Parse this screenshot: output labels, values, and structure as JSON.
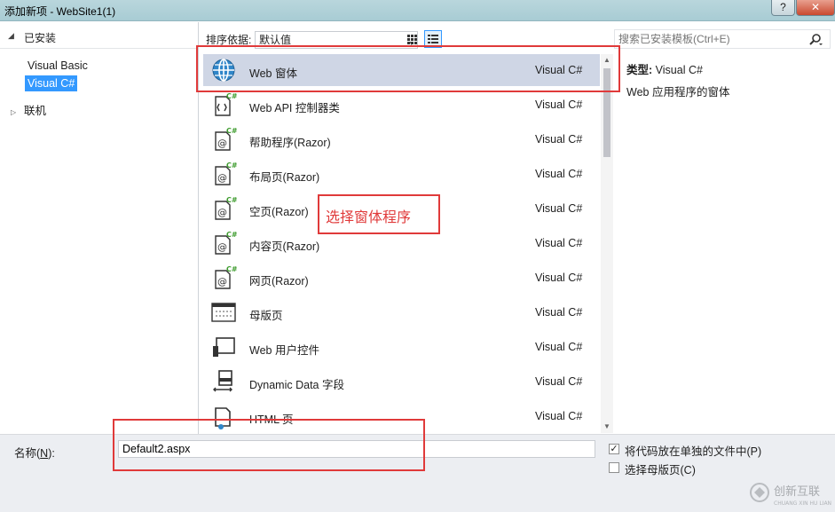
{
  "window": {
    "title": "添加新项 - WebSite1(1)",
    "help_label": "?",
    "close_label": "✕"
  },
  "left_panel": {
    "header": "已安装",
    "items": [
      {
        "label": "Visual Basic"
      },
      {
        "label": "Visual C#"
      }
    ],
    "online_label": "联机"
  },
  "toolbar": {
    "sort_label": "排序依据:",
    "sort_value": "默认值"
  },
  "templates": [
    {
      "name": "Web 窗体",
      "language": "Visual C#",
      "icon": "globe-icon"
    },
    {
      "name": "Web API 控制器类",
      "language": "Visual C#",
      "icon": "csharp-class-icon"
    },
    {
      "name": "帮助程序(Razor)",
      "language": "Visual C#",
      "icon": "razor-page-icon"
    },
    {
      "name": "布局页(Razor)",
      "language": "Visual C#",
      "icon": "razor-page-icon"
    },
    {
      "name": "空页(Razor)",
      "language": "Visual C#",
      "icon": "razor-page-icon"
    },
    {
      "name": "内容页(Razor)",
      "language": "Visual C#",
      "icon": "razor-page-icon"
    },
    {
      "name": "网页(Razor)",
      "language": "Visual C#",
      "icon": "razor-page-icon"
    },
    {
      "name": "母版页",
      "language": "Visual C#",
      "icon": "master-page-icon"
    },
    {
      "name": "Web 用户控件",
      "language": "Visual C#",
      "icon": "user-control-icon"
    },
    {
      "name": "Dynamic Data 字段",
      "language": "Visual C#",
      "icon": "dynamic-data-icon"
    },
    {
      "name": "HTML 页",
      "language": "Visual C#",
      "icon": "html-page-icon"
    }
  ],
  "right_panel": {
    "search_placeholder": "搜索已安装模板(Ctrl+E)",
    "type_label": "类型:",
    "type_value": "Visual C#",
    "description": "Web 应用程序的窗体"
  },
  "bottom": {
    "name_label_prefix": "名称(",
    "name_label_key": "N",
    "name_label_suffix": "):",
    "name_value": "Default2.aspx",
    "option_code_file": "将代码放在单独的文件中(P)",
    "option_code_file_checked": true,
    "option_master_page": "选择母版页(C)",
    "option_master_page_checked": false
  },
  "annotation": {
    "callout_text": "选择窗体程序"
  },
  "watermark": {
    "text": "创新互联",
    "subtext": "CHUANG XIN HU LIAN"
  }
}
